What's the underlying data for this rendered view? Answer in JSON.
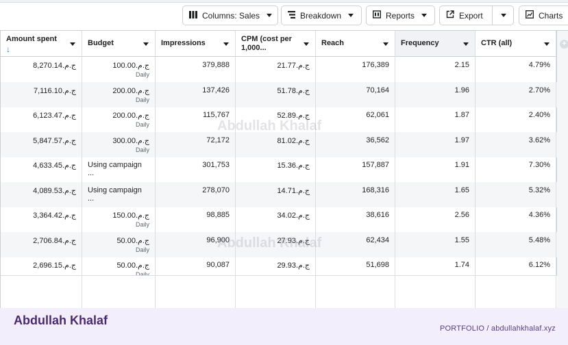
{
  "toolbar": {
    "columns_label": "Columns: Sales",
    "breakdown_label": "Breakdown",
    "reports_label": "Reports",
    "export_label": "Export",
    "charts_label": "Charts"
  },
  "table": {
    "headers": [
      {
        "label": "Amount spent",
        "sorted": "desc"
      },
      {
        "label": "Budget"
      },
      {
        "label": "Impressions"
      },
      {
        "label": "CPM (cost per 1,000..."
      },
      {
        "label": "Reach"
      },
      {
        "label": "Frequency",
        "selected": true
      },
      {
        "label": "CTR (all)"
      }
    ],
    "sort_arrow": "↓",
    "rows": [
      {
        "amount": "ج.م.8,270.14",
        "budget": "ج.م.100.00",
        "budget_sub": "Daily",
        "impressions": "379,888",
        "cpm": "ج.م.21.77",
        "reach": "176,389",
        "frequency": "2.15",
        "ctr": "4.79%"
      },
      {
        "amount": "ج.م.7,116.10",
        "budget": "ج.م.200.00",
        "budget_sub": "Daily",
        "impressions": "137,426",
        "cpm": "ج.م.51.78",
        "reach": "70,164",
        "frequency": "1.96",
        "ctr": "2.70%"
      },
      {
        "amount": "ج.م.6,123.47",
        "budget": "ج.م.200.00",
        "budget_sub": "Daily",
        "impressions": "115,767",
        "cpm": "ج.م.52.89",
        "reach": "62,061",
        "frequency": "1.87",
        "ctr": "2.40%"
      },
      {
        "amount": "ج.م.5,847.57",
        "budget": "ج.م.300.00",
        "budget_sub": "Daily",
        "impressions": "72,172",
        "cpm": "ج.م.81.02",
        "reach": "36,562",
        "frequency": "1.97",
        "ctr": "3.62%"
      },
      {
        "amount": "ج.م.4,633.45",
        "budget": "Using campaign ...",
        "budget_sub": "",
        "impressions": "301,753",
        "cpm": "ج.م.15.36",
        "reach": "157,887",
        "frequency": "1.91",
        "ctr": "7.30%"
      },
      {
        "amount": "ج.م.4,089.53",
        "budget": "Using campaign ...",
        "budget_sub": "",
        "impressions": "278,070",
        "cpm": "ج.م.14.71",
        "reach": "168,316",
        "frequency": "1.65",
        "ctr": "5.32%"
      },
      {
        "amount": "ج.م.3,364.42",
        "budget": "ج.م.150.00",
        "budget_sub": "Daily",
        "impressions": "98,885",
        "cpm": "ج.م.34.02",
        "reach": "38,616",
        "frequency": "2.56",
        "ctr": "4.36%"
      },
      {
        "amount": "ج.م.2,706.84",
        "budget": "ج.م.50.00",
        "budget_sub": "Daily",
        "impressions": "96,900",
        "cpm": "ج.م.27.93",
        "reach": "62,434",
        "frequency": "1.55",
        "ctr": "5.48%"
      },
      {
        "amount": "ج.م.2,696.15",
        "budget": "ج.م.50.00",
        "budget_sub": "Daily",
        "impressions": "90,087",
        "cpm": "ج.م.29.93",
        "reach": "51,698",
        "frequency": "1.74",
        "ctr": "6.12%"
      }
    ]
  },
  "watermark": "Abdullah Khalaf",
  "footer": {
    "brand": "Abdullah Khalaf",
    "portfolio": "PORTFOLIO  /  abdullahkhalaf.xyz"
  },
  "colors": {
    "accent": "#1877f2",
    "footer_bg": "#f3eefb",
    "brand": "#4a2a6e"
  }
}
